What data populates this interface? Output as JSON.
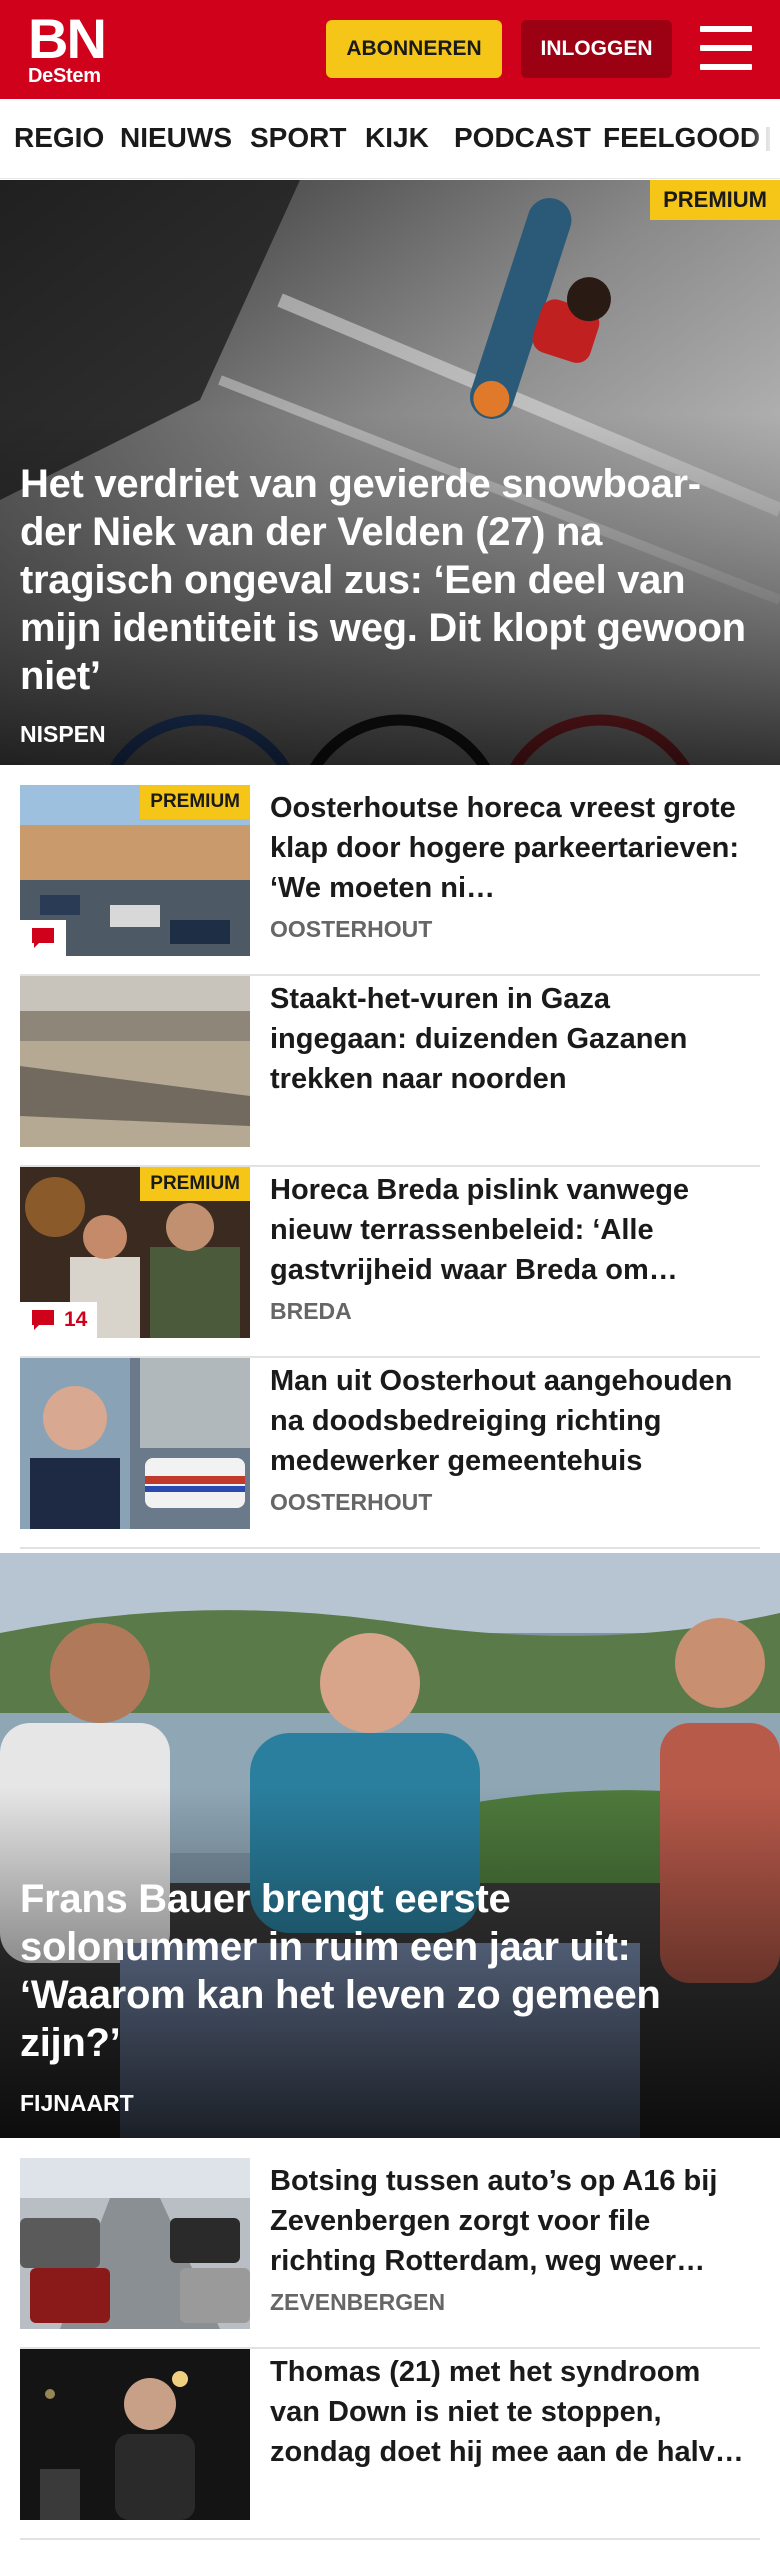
{
  "header": {
    "logo_main": "BN",
    "logo_sub": "DeStem",
    "subscribe_label": "ABONNEREN",
    "login_label": "INLOGGEN",
    "menu_icon": "hamburger-menu-icon",
    "brand_color": "#d0011b",
    "subscribe_color": "#f5c518",
    "login_color": "#9b0013"
  },
  "nav": {
    "items": [
      "REGIO",
      "NIEUWS",
      "SPORT",
      "KIJK",
      "PODCAST",
      "FEELGOOD"
    ]
  },
  "hero1": {
    "badge": "PREMIUM",
    "title": "Het verdriet van gevierde snowboar-der Niek van der Velden (27) na tragisch ongeval zus: ‘Een deel van mijn identiteit is weg. Dit klopt gewoon niet’",
    "location": "NISPEN"
  },
  "articles1": [
    {
      "title": "Oosterhoutse horeca vreest grote klap door hogere parkeertarieven: ‘We moeten ni…",
      "location": "OOSTERHOUT",
      "badge": "PREMIUM",
      "comments": ""
    },
    {
      "title": "Staakt-het-vuren in Gaza ingegaan: duizenden Gazanen trekken naar noorden",
      "location": "",
      "badge": "",
      "comments": ""
    },
    {
      "title": "Horeca Breda pislink vanwege nieuw terrassenbeleid: ‘Alle gastvrijheid waar Breda om…",
      "location": "BREDA",
      "badge": "PREMIUM",
      "comments": "14"
    },
    {
      "title": "Man uit Oosterhout aangehouden na doodsbedreiging richting medewerker gemeentehuis",
      "location": "OOSTERHOUT",
      "badge": "",
      "comments": ""
    }
  ],
  "hero2": {
    "title": "Frans Bauer brengt eerste solonummer in ruim een jaar uit: ‘Waarom kan het leven zo gemeen zijn?’",
    "location": "FIJNAART"
  },
  "articles2": [
    {
      "title": "Botsing tussen auto’s op A16 bij Zevenbergen zorgt voor file richting Rotterdam, weg weer…",
      "location": "ZEVENBERGEN"
    },
    {
      "title": "Thomas (21) met het syndroom van Down is niet te stoppen, zondag doet hij mee aan de halv…",
      "location": ""
    }
  ]
}
